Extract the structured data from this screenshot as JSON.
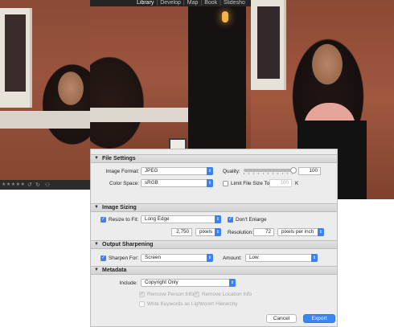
{
  "app": {
    "modules": [
      {
        "label": "Library",
        "active": true
      },
      {
        "label": "Develop",
        "active": false
      },
      {
        "label": "Map",
        "active": false
      },
      {
        "label": "Book",
        "active": false
      },
      {
        "label": "Slidesho",
        "active": false
      }
    ],
    "module_separator": "|"
  },
  "filmstrip": {
    "stars": "★★★★★",
    "icons": [
      "rotate-left-icon",
      "rotate-right-icon",
      "compare-icon"
    ]
  },
  "colors": {
    "accent": "#3b82f0",
    "dialog_bg": "#ececec",
    "header_bg": "#d8d8d8",
    "module_bar_bg": "#242424"
  },
  "sections": {
    "file_settings": {
      "title": "File Settings",
      "image_format_label": "Image Format:",
      "image_format_value": "JPEG",
      "quality_label": "Quality:",
      "quality_value": "100",
      "quality_level": 1.0,
      "color_space_label": "Color Space:",
      "color_space_value": "sRGB",
      "limit_size_label": "Limit File Size To:",
      "limit_size_checked": false,
      "limit_size_value": "100",
      "limit_size_unit": "K"
    },
    "image_sizing": {
      "title": "Image Sizing",
      "resize_label": "Resize to Fit:",
      "resize_checked": true,
      "resize_value": "Long Edge",
      "dont_enlarge_label": "Don't Enlarge",
      "dont_enlarge_checked": true,
      "size_value": "2,750",
      "size_unit": "pixels",
      "resolution_label": "Resolution:",
      "resolution_value": "72",
      "resolution_unit": "pixels per inch"
    },
    "output_sharpening": {
      "title": "Output Sharpening",
      "sharpen_label": "Sharpen For:",
      "sharpen_checked": true,
      "sharpen_value": "Screen",
      "amount_label": "Amount:",
      "amount_value": "Low"
    },
    "metadata": {
      "title": "Metadata",
      "include_label": "Include:",
      "include_value": "Copyright Only",
      "remove_person_label": "Remove Person Info",
      "remove_location_label": "Remove Location Info",
      "write_keywords_label": "Write Keywords as Lightroom Hierarchy"
    }
  },
  "buttons": {
    "cancel": "Cancel",
    "export": "Export"
  }
}
